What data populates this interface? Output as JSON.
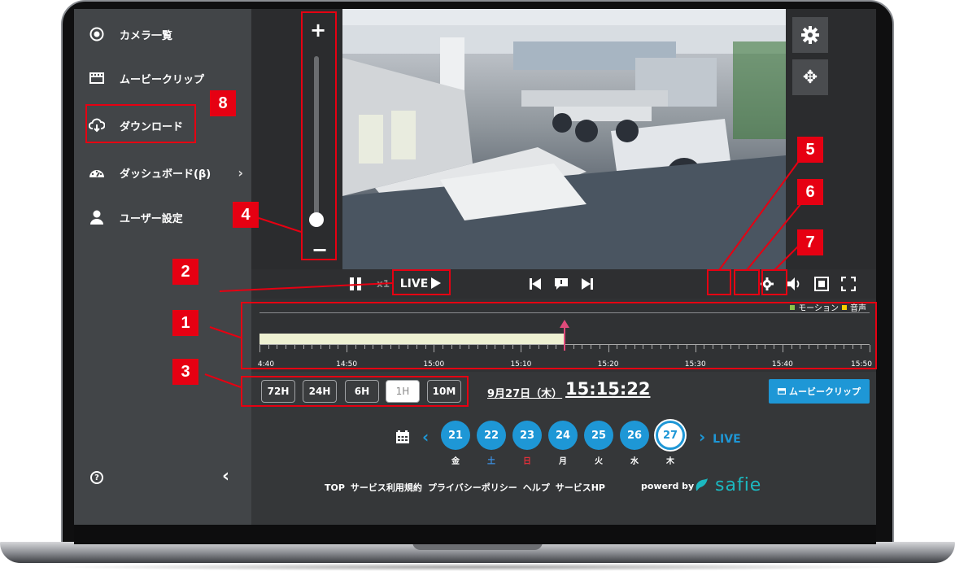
{
  "sidebar": {
    "items": [
      {
        "label": "カメラ一覧",
        "icon": "camera-list-icon"
      },
      {
        "label": "ムービークリップ",
        "icon": "film-icon"
      },
      {
        "label": "ダウンロード",
        "icon": "cloud-download-icon"
      },
      {
        "label": "ダッシュボード(β)",
        "icon": "dashboard-icon"
      },
      {
        "label": "ユーザー設定",
        "icon": "user-icon"
      }
    ],
    "help_icon": "help-circle-icon",
    "collapse_icon": "chevron-left-icon"
  },
  "zoom": {
    "plus": "+",
    "minus": "−",
    "level": 0.08
  },
  "player": {
    "speed_label": "x1",
    "live_label": "LIVE",
    "icons": [
      "pause-icon",
      "play-icon",
      "skip-back-icon",
      "event-flag-icon",
      "skip-forward-icon",
      "gear-icon",
      "volume-icon",
      "snapshot-icon",
      "fullscreen-icon",
      "move-icon"
    ]
  },
  "timeline": {
    "legend": [
      {
        "label": "モーション",
        "color": "#8bc34a"
      },
      {
        "label": "音声",
        "color": "#f5d000"
      }
    ],
    "tick_labels": [
      "4:40",
      "14:50",
      "15:00",
      "15:10",
      "15:20",
      "15:30",
      "15:40",
      "15:50"
    ],
    "recorded_until": "15:15",
    "playhead": "15:15"
  },
  "ranges": [
    "72H",
    "24H",
    "6H",
    "1H",
    "10M"
  ],
  "active_range": "1H",
  "date": "9月27日（木）",
  "time": "15:15:22",
  "clip_button": "ムービークリップ",
  "calendar": {
    "days": [
      {
        "num": "21",
        "dow": "金",
        "dow_color": "#ffffff"
      },
      {
        "num": "22",
        "dow": "土",
        "dow_color": "#3b8fe0"
      },
      {
        "num": "23",
        "dow": "日",
        "dow_color": "#e0303a"
      },
      {
        "num": "24",
        "dow": "月",
        "dow_color": "#ffffff"
      },
      {
        "num": "25",
        "dow": "火",
        "dow_color": "#ffffff"
      },
      {
        "num": "26",
        "dow": "水",
        "dow_color": "#ffffff"
      },
      {
        "num": "27",
        "dow": "木",
        "dow_color": "#ffffff"
      }
    ],
    "today": "27",
    "next_label": "LIVE"
  },
  "footer": {
    "links": [
      "TOP",
      "サービス利用規約",
      "プライバシーポリシー",
      "ヘルプ",
      "サービスHP"
    ],
    "powered": "powerd by",
    "brand": "safie"
  },
  "annotations": [
    "1",
    "2",
    "3",
    "4",
    "5",
    "6",
    "7",
    "8"
  ],
  "colors": {
    "accent": "#1e97d6",
    "annotation": "#e60012",
    "sidebar": "#424548",
    "background": "#353739"
  }
}
